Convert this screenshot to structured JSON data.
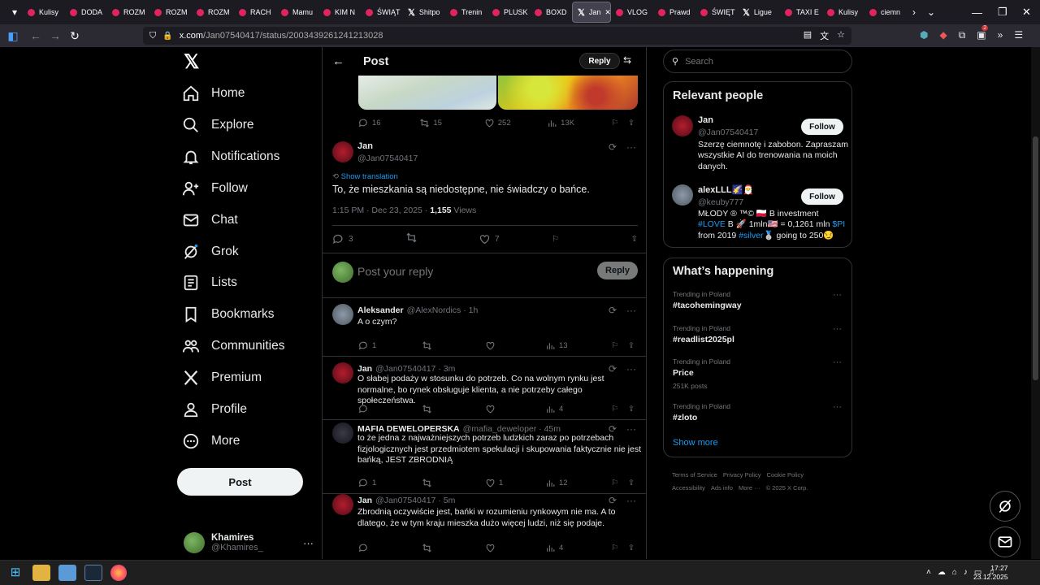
{
  "browser": {
    "tabs": [
      "Kulisy",
      "DODA",
      "ROZM",
      "ROZM",
      "ROZM",
      "RACH",
      "Mamu",
      "KIM N",
      "ŚWIĄT",
      "Shitpo",
      "Trenin",
      "PLUSK",
      "BOXD",
      "Jan",
      "VLOG",
      "Prawd",
      "ŚWIĘT",
      "Ligue",
      "TAXI E",
      "Kulisy",
      "ciemn"
    ],
    "active_tab_index": 13,
    "url_host": "x.com",
    "url_path": "/Jan07540417/status/2003439261241213028",
    "notification_count": "2"
  },
  "nav": {
    "items": [
      "Home",
      "Explore",
      "Notifications",
      "Follow",
      "Chat",
      "Grok",
      "Lists",
      "Bookmarks",
      "Communities",
      "Premium",
      "Profile",
      "More"
    ],
    "post_button": "Post",
    "account_name": "Khamires",
    "account_handle": "@Khamires_"
  },
  "header": {
    "title": "Post",
    "reply_button": "Reply"
  },
  "prev_tweet_actions": {
    "replies": "16",
    "reposts": "15",
    "likes": "252",
    "views": "13K"
  },
  "main_tweet": {
    "name": "Jan",
    "handle": "@Jan07540417",
    "show_translation": "Show translation",
    "text": "To, że mieszkania są niedostępne, nie świadczy o bańce.",
    "time": "1:15 PM · Dec 23, 2025 · ",
    "views_count": "1,155",
    "views_label": " Views",
    "replies": "3",
    "likes": "7"
  },
  "composer": {
    "placeholder": "Post your reply",
    "button": "Reply"
  },
  "replies": [
    {
      "name": "Aleksander",
      "meta": "@AlexNordics · 1h",
      "text": "A o czym?",
      "replies": "1",
      "reposts": "",
      "likes": "",
      "views": "13"
    },
    {
      "name": "Jan",
      "meta": "@Jan07540417 · 3m",
      "text": "O słabej podaży w stosunku do potrzeb. Co na wolnym rynku jest normalne, bo rynek obsługuje klienta, a nie potrzeby całego społeczeństwa.",
      "replies": "",
      "reposts": "",
      "likes": "",
      "views": "4"
    },
    {
      "name": "MAFIA DEWELOPERSKA",
      "meta": "@mafia_deweloper · 45m",
      "text": "to że jedna z najważniejszych potrzeb ludzkich zaraz po potrzebach fizjologicznych jest przedmiotem spekulacji i skupowania faktycznie nie jest bańką, JEST ZBRODNIĄ",
      "replies": "1",
      "reposts": "",
      "likes": "1",
      "views": "12"
    },
    {
      "name": "Jan",
      "meta": "@Jan07540417 · 5m",
      "text": "Zbrodnią oczywiście jest, bańki w rozumieniu rynkowym nie ma. A to dlatego, że w tym kraju mieszka dużo więcej ludzi, niż się podaje.",
      "replies": "",
      "reposts": "",
      "likes": "",
      "views": "4"
    }
  ],
  "search": {
    "placeholder": "Search"
  },
  "relevant_people": {
    "title": "Relevant people",
    "follow_label": "Follow",
    "people": [
      {
        "name": "Jan",
        "handle": "@Jan07540417",
        "bio": "Szerzę ciemnotę i zabobon. Zapraszam wszystkie AI do trenowania na moich danych."
      },
      {
        "name": "alexLLL🌠🎅",
        "handle": "@keuby777",
        "bio_a": "MŁODY ® ™© 🇵🇱 B investment ",
        "bio_tag1": "#LOVE",
        "bio_b": " B 🚀 1mln🇺🇸 = 0,1261 mln ",
        "bio_tag2": "$PI",
        "bio_c": " from 2019 ",
        "bio_tag3": "#silver",
        "bio_d": "🥈 going to 250😏"
      }
    ]
  },
  "whats_happening": {
    "title": "What’s happening",
    "trends": [
      {
        "context": "Trending in Poland",
        "topic": "#tacohemingway",
        "count": ""
      },
      {
        "context": "Trending in Poland",
        "topic": "#readlist2025pl",
        "count": ""
      },
      {
        "context": "Trending in Poland",
        "topic": "Price",
        "count": "251K posts"
      },
      {
        "context": "Trending in Poland",
        "topic": "#zloto",
        "count": ""
      }
    ],
    "show_more": "Show more"
  },
  "footer": [
    "Terms of Service",
    "Privacy Policy",
    "Cookie Policy",
    "Accessibility",
    "Ads info",
    "More ···",
    "© 2025 X Corp."
  ],
  "taskbar": {
    "time": "17:27",
    "date": "23.12.2025"
  }
}
